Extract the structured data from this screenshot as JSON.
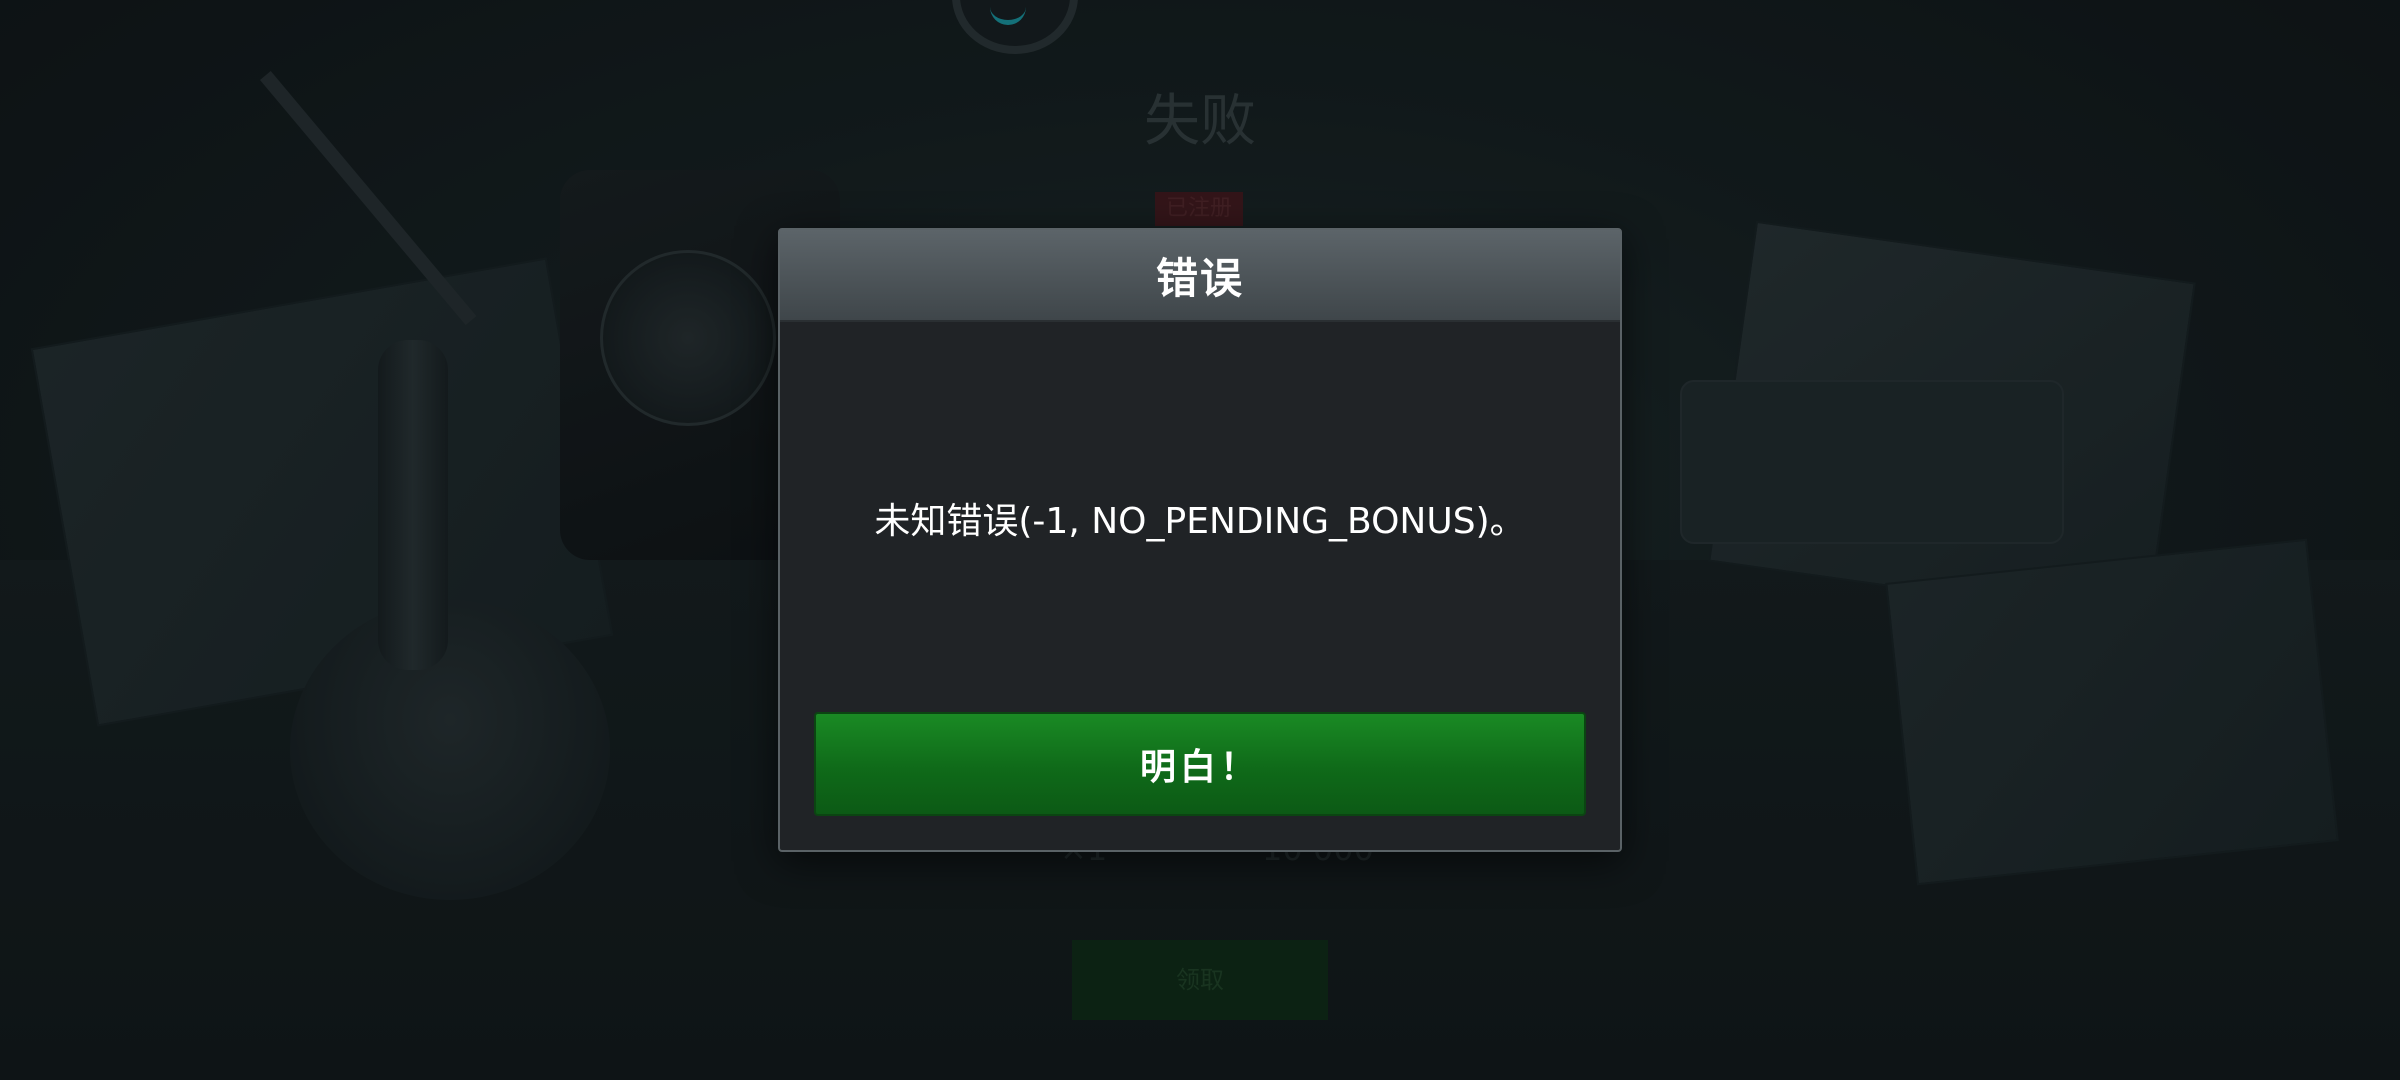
{
  "background": {
    "result_title": "失败",
    "badge_text": "已注册",
    "stat_multiplier": "×1",
    "stat_amount": "10 000",
    "claim_button_label": "领取"
  },
  "dialog": {
    "title": "错误",
    "message": "未知错误(-1, NO_PENDING_BONUS)。",
    "ok_button_label": "明白！"
  },
  "colors": {
    "header_gradient_top": "#5c6469",
    "header_gradient_bottom": "#3f464a",
    "dialog_body": "#202326",
    "button_green": "#0f6a19",
    "spinner_accent": "#1ba7b3"
  }
}
